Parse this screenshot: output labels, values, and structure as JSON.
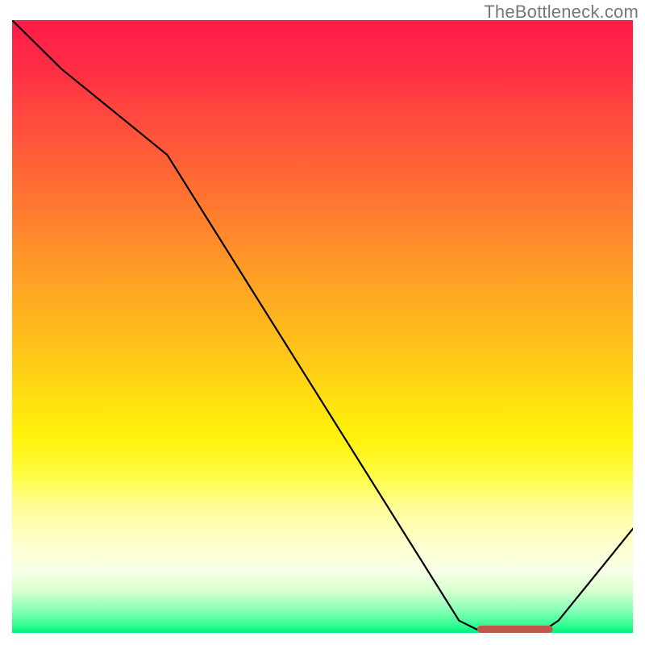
{
  "watermark": "TheBottleneck.com",
  "chart_data": {
    "type": "line",
    "title": "",
    "xlabel": "",
    "ylabel": "",
    "xlim": [
      0,
      100
    ],
    "ylim": [
      0,
      100
    ],
    "grid": false,
    "series": [
      {
        "name": "curve",
        "x": [
          0,
          8,
          25,
          72,
          76,
          85,
          88,
          100
        ],
        "y": [
          100,
          92,
          78,
          2,
          0,
          0,
          2,
          17
        ]
      }
    ],
    "marker_segment": {
      "x0": 75.5,
      "x1": 86.5,
      "y": 0.6,
      "color": "#c0574f",
      "thickness_pct": 1.2,
      "cap": "round"
    },
    "background_gradient": {
      "type": "vertical",
      "stops": [
        {
          "pos": 0.0,
          "color": "#ff1a48"
        },
        {
          "pos": 0.4,
          "color": "#ff9927"
        },
        {
          "pos": 0.68,
          "color": "#fff20a"
        },
        {
          "pos": 0.86,
          "color": "#fcffd0"
        },
        {
          "pos": 1.0,
          "color": "#00f081"
        }
      ]
    }
  }
}
